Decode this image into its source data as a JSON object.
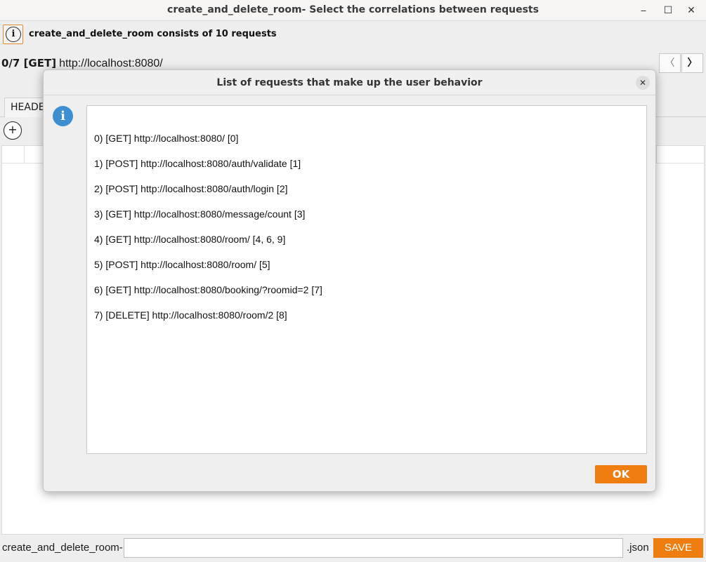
{
  "window": {
    "title": "create_and_delete_room- Select the correlations between requests",
    "minimize_glyph": "⎯",
    "maximize_glyph": "☐",
    "close_glyph": "✕"
  },
  "infobar": {
    "icon": "info-icon",
    "icon_glyph": "i",
    "message": "create_and_delete_room consists of 10 requests"
  },
  "request": {
    "index": "0/7 [GET]",
    "url": "http://localhost:8080/"
  },
  "nav": {
    "prev": "〈",
    "next": "〉"
  },
  "tabs": [
    {
      "label": "HEADERS"
    }
  ],
  "add_icon_glyph": "+",
  "bottombar": {
    "prefix": "create_and_delete_room-",
    "filename_value": "",
    "extension": ".json",
    "save_label": "SAVE"
  },
  "dialog": {
    "title": "List of requests that make up the user behavior",
    "close_glyph": "✕",
    "info_icon_glyph": "i",
    "lines": [
      "0)  [GET] http://localhost:8080/ [0]",
      "1)  [POST] http://localhost:8080/auth/validate [1]",
      "2)  [POST] http://localhost:8080/auth/login [2]",
      "3)  [GET] http://localhost:8080/message/count [3]",
      "4)  [GET] http://localhost:8080/room/ [4, 6, 9]",
      "5)  [POST] http://localhost:8080/room/ [5]",
      "6)  [GET] http://localhost:8080/booking/?roomid=2 [7]",
      "7)  [DELETE] http://localhost:8080/room/2 [8]"
    ],
    "ok_label": "OK"
  },
  "colors": {
    "accent": "#f07d0f",
    "info_blue": "#3d8fd1",
    "window_bg": "#eeeeee"
  }
}
